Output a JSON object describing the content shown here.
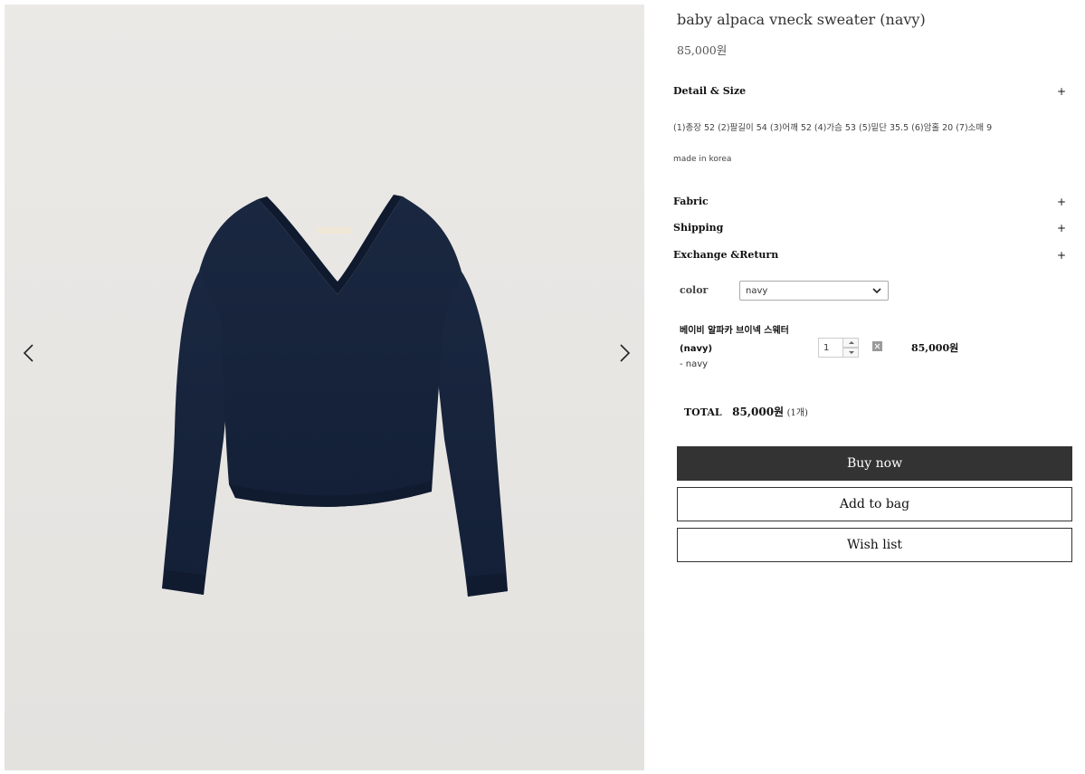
{
  "product": {
    "title": "baby alpaca vneck sweater (navy)",
    "price": "85,000원",
    "image_subject": "navy-sweater"
  },
  "gallery": {
    "prev_icon": "chevron-left-icon",
    "next_icon": "chevron-right-icon"
  },
  "accordion": {
    "detail": {
      "label": "Detail & Size",
      "toggle": "+"
    },
    "fabric": {
      "label": "Fabric",
      "toggle": "+"
    },
    "shipping": {
      "label": "Shipping",
      "toggle": "+"
    },
    "exchange": {
      "label": "Exchange &Return",
      "toggle": "+"
    }
  },
  "detail": {
    "sizes": "(1)총장 52 (2)팔길이 54 (3)어깨 52 (4)가슴 53 (5)밑단 35.5 (6)암홀 20 (7)소매 9",
    "origin": "made in korea"
  },
  "option": {
    "color_label": "color",
    "color_value": "navy"
  },
  "selected_item": {
    "name": "베이비 알파카 브이넥 스웨터 (navy)",
    "option": "- navy",
    "quantity": "1",
    "price": "85,000원"
  },
  "total": {
    "label": "TOTAL",
    "amount": "85,000원",
    "count": "(1개)"
  },
  "actions": {
    "buy_now": "Buy now",
    "add_to_bag": "Add to bag",
    "wish_list": "Wish list"
  },
  "colors": {
    "sweater": "#15223a",
    "wall": "#e9e7e4",
    "buy_button": "#333333"
  }
}
